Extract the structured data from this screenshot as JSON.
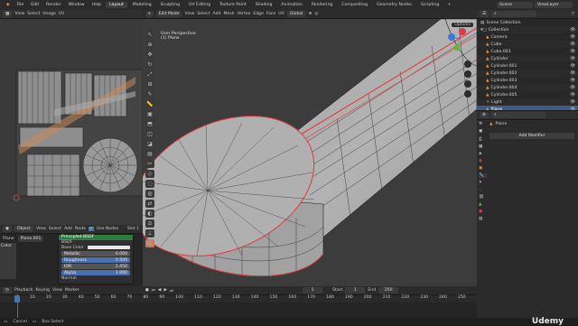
{
  "top_menu": [
    "File",
    "Edit",
    "Render",
    "Window",
    "Help"
  ],
  "workspaces": [
    "Layout",
    "Modeling",
    "Sculpting",
    "UV Editing",
    "Texture Paint",
    "Shading",
    "Animation",
    "Rendering",
    "Compositing",
    "Geometry Nodes",
    "Scripting"
  ],
  "active_workspace": "Layout",
  "scene_label": "Scene",
  "view_layer_label": "ViewLayer",
  "uv_header": [
    "View",
    "Select",
    "Image",
    "UV"
  ],
  "viewport_header": {
    "mode": "Edit Mode",
    "menus": [
      "View",
      "Select",
      "Add",
      "Mesh",
      "Vertex",
      "Edge",
      "Face",
      "UV"
    ],
    "transform": "Global",
    "options": "Options"
  },
  "viewport_info": {
    "line1": "User Perspective",
    "line2": "(1) Plane"
  },
  "outliner": {
    "title": "Scene Collection",
    "rows": [
      "Collection",
      "Camera",
      "Cube",
      "Cube.001",
      "Cylinder",
      "Cylinder.001",
      "Cylinder.002",
      "Cylinder.003",
      "Cylinder.004",
      "Cylinder.005",
      "Light",
      "Plane",
      "Plane.001"
    ],
    "selected": "Plane"
  },
  "properties": {
    "object_name": "Plane",
    "add_modifier": "Add Modifier"
  },
  "node_editor": {
    "header": [
      "Object",
      "View",
      "Select",
      "Add",
      "Node"
    ],
    "use_nodes": "Use Nodes",
    "slot": "Slot 1",
    "material": "Plane.001",
    "node_title": "Principled BSDF",
    "node_sub": "BSDF",
    "rows": [
      {
        "label": "Base Color",
        "value": ""
      },
      {
        "label": "Metallic",
        "value": "0.000"
      },
      {
        "label": "Roughness",
        "value": "0.500"
      },
      {
        "label": "IOR",
        "value": "1.450"
      },
      {
        "label": "Alpha",
        "value": "1.000"
      },
      {
        "label": "Normal",
        "value": ""
      }
    ],
    "left_labels": [
      "Plane",
      "Color"
    ]
  },
  "timeline": {
    "menus": [
      "Playback",
      "Keying",
      "View",
      "Marker"
    ],
    "current": "1",
    "start_label": "Start",
    "start": "1",
    "end_label": "End",
    "end": "250",
    "ticks": [
      "0",
      "10",
      "20",
      "30",
      "40",
      "50",
      "60",
      "70",
      "80",
      "90",
      "100",
      "110",
      "120",
      "130",
      "140",
      "150",
      "160",
      "170",
      "180",
      "190",
      "200",
      "210",
      "220",
      "230",
      "240",
      "250"
    ]
  },
  "status": [
    "Cancel",
    "Box Select"
  ],
  "watermark": "Udemy",
  "colors": {
    "accent": "#4772b3",
    "selection_edge": "#e23b3b",
    "bg": "#1d1d1d",
    "viewport": "#3c3c3c",
    "mesh": "#9a9a9a"
  }
}
